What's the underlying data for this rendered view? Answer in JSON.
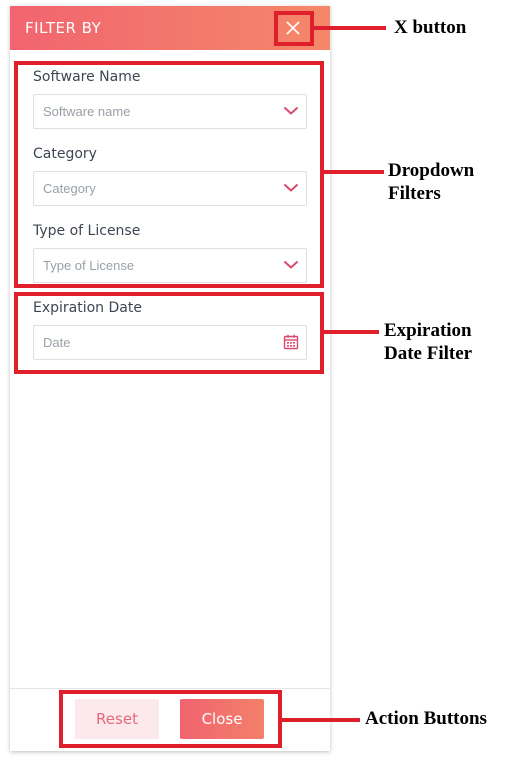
{
  "panel": {
    "title": "FILTER BY",
    "close_icon": "close-icon"
  },
  "filters": [
    {
      "label": "Software Name",
      "placeholder": "Software name",
      "icon": "chevron-down-icon"
    },
    {
      "label": "Category",
      "placeholder": "Category",
      "icon": "chevron-down-icon"
    },
    {
      "label": "Type of License",
      "placeholder": "Type of License",
      "icon": "chevron-down-icon"
    },
    {
      "label": "Expiration Date",
      "placeholder": "Date",
      "icon": "calendar-icon"
    }
  ],
  "footer": {
    "reset_label": "Reset",
    "close_label": "Close"
  },
  "annotations": {
    "x_button": "X button",
    "dropdown_filters_line1": "Dropdown",
    "dropdown_filters_line2": "Filters",
    "expiration_line1": "Expiration",
    "expiration_line2": "Date Filter",
    "action_buttons": "Action Buttons"
  },
  "colors": {
    "accent_start": "#f2646f",
    "accent_end": "#f4886a",
    "annotation_red": "#e01f2c",
    "chevron": "#d94a6e"
  }
}
